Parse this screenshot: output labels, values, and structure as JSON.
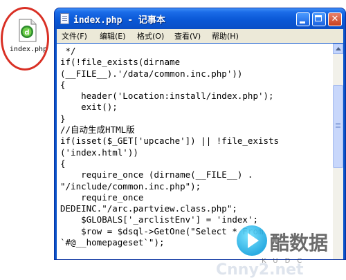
{
  "desktop": {
    "file_icon": {
      "label": "index.php",
      "icon": "dreamweaver-php-file-icon"
    }
  },
  "window": {
    "title": "index.php - 记事本",
    "icon": "notepad-icon",
    "buttons": {
      "minimize": "minimize-icon",
      "maximize": "maximize-icon",
      "close": "close-icon"
    }
  },
  "menu": {
    "items": [
      {
        "label": "文件(F)"
      },
      {
        "label": "编辑(E)"
      },
      {
        "label": "格式(O)"
      },
      {
        "label": "查看(V)"
      },
      {
        "label": "帮助(H)"
      }
    ]
  },
  "editor": {
    "content": " */\nif(!file_exists(dirname\n(__FILE__).'/data/common.inc.php'))\n{\n    header('Location:install/index.php');\n    exit();\n}\n//自动生成HTML版\nif(isset($_GET['upcache']) || !file_exists\n('index.html'))\n{\n    require_once (dirname(__FILE__) .\n\"/include/common.inc.php\");\n    require_once\nDEDEINC.\"/arc.partview.class.php\";\n    $GLOBALS['_arclistEnv'] = 'index';\n    $row = $dsql->GetOne(\"Select * From\n`#@__homepageset`\");"
  },
  "watermark": {
    "text": "酷数据",
    "sub": "KUDC",
    "faint": "Cnny2.net"
  },
  "colors": {
    "titlebar": "#0a58d6",
    "menubar": "#ece9d8",
    "highlight_oval": "#d93025"
  }
}
